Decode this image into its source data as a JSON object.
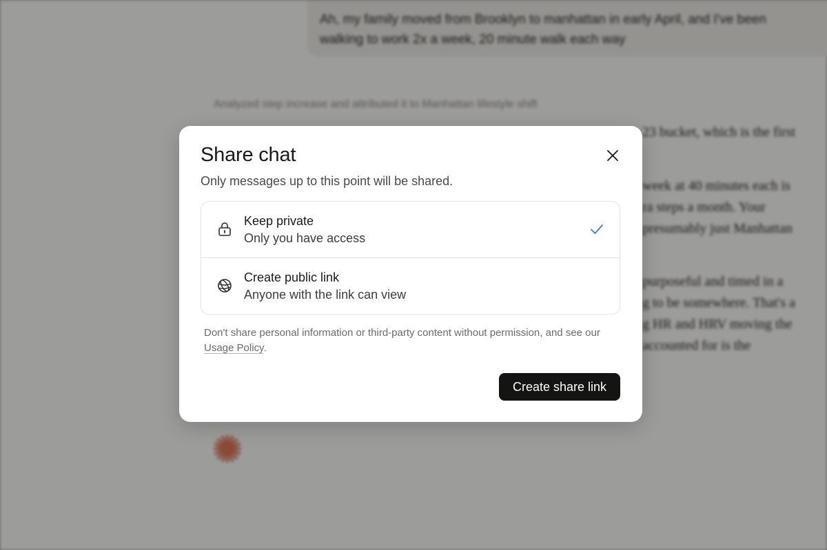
{
  "background_chat": {
    "user_message_lines": [
      "Ah, my family moved from Brooklyn to manhattan in early April, and I've been",
      "walking to work 2x a week, 20 minute walk each way"
    ],
    "thinking_summary": "Analyzed step increase and attributed it to Manhattan lifestyle shift",
    "reply_fragments": [
      "23 bucket, which is the first",
      "week at 40 minutes each is",
      "ra steps a month. Your",
      "presumably just Manhattan",
      "purposeful and timed in a",
      "g to be somewhere. That's a",
      "g HR and HRV moving the",
      "accounted for is the"
    ]
  },
  "modal": {
    "title": "Share chat",
    "subtitle": "Only messages up to this point will be shared.",
    "options": [
      {
        "icon": "lock-icon",
        "title": "Keep private",
        "description": "Only you have access",
        "selected": true
      },
      {
        "icon": "globe-icon",
        "title": "Create public link",
        "description": "Anyone with the link can view",
        "selected": false
      }
    ],
    "disclaimer_text": "Don't share personal information or third-party content without permission, and see our ",
    "policy_link_label": "Usage Policy",
    "disclaimer_end": ".",
    "primary_button_label": "Create share link"
  },
  "colors": {
    "accent_check": "#3b7dd8",
    "primary_button": "#141413",
    "claude_spark": "#d97757"
  }
}
